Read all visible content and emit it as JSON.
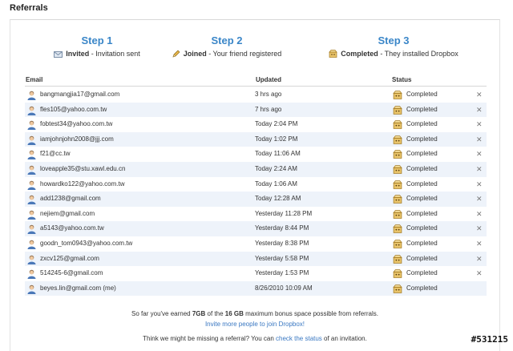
{
  "page": {
    "title": "Referrals"
  },
  "steps": [
    {
      "title": "Step 1",
      "status": "Invited",
      "desc": " - Invitation sent",
      "icon": "envelope-icon"
    },
    {
      "title": "Step 2",
      "status": "Joined",
      "desc": " - Your friend registered",
      "icon": "pencil-icon"
    },
    {
      "title": "Step 3",
      "status": "Completed",
      "desc": " - They installed Dropbox",
      "icon": "dropbox-box-icon"
    }
  ],
  "table": {
    "headers": {
      "email": "Email",
      "updated": "Updated",
      "status": "Status"
    },
    "rows": [
      {
        "email": "bangmangjia17@gmail.com",
        "updated": "3 hrs ago",
        "status": "Completed",
        "removable": true
      },
      {
        "email": "fles105@yahoo.com.tw",
        "updated": "7 hrs ago",
        "status": "Completed",
        "removable": true
      },
      {
        "email": "fobtest34@yahoo.com.tw",
        "updated": "Today 2:04 PM",
        "status": "Completed",
        "removable": true
      },
      {
        "email": "iamjohnjohn2008@jjj.com",
        "updated": "Today 1:02 PM",
        "status": "Completed",
        "removable": true
      },
      {
        "email": "f21@cc.tw",
        "updated": "Today 11:06 AM",
        "status": "Completed",
        "removable": true
      },
      {
        "email": "loveapple35@stu.xawl.edu.cn",
        "updated": "Today 2:24 AM",
        "status": "Completed",
        "removable": true
      },
      {
        "email": "howardko122@yahoo.com.tw",
        "updated": "Today 1:06 AM",
        "status": "Completed",
        "removable": true
      },
      {
        "email": "add1238@gmail.com",
        "updated": "Today 12:28 AM",
        "status": "Completed",
        "removable": true
      },
      {
        "email": "nejiem@gmail.com",
        "updated": "Yesterday 11:28 PM",
        "status": "Completed",
        "removable": true
      },
      {
        "email": "a5143@yahoo.com.tw",
        "updated": "Yesterday 8:44 PM",
        "status": "Completed",
        "removable": true
      },
      {
        "email": "goodn_tom0943@yahoo.com.tw",
        "updated": "Yesterday 8:38 PM",
        "status": "Completed",
        "removable": true
      },
      {
        "email": "zxcv125@gmail.com",
        "updated": "Yesterday 5:58 PM",
        "status": "Completed",
        "removable": true
      },
      {
        "email": "514245-6@gmail.com",
        "updated": "Yesterday 1:53 PM",
        "status": "Completed",
        "removable": true
      },
      {
        "email": "beyes.lin@gmail.com (me)",
        "updated": "8/26/2010 10:09 AM",
        "status": "Completed",
        "removable": false
      }
    ],
    "remove_glyph": "✕"
  },
  "footer": {
    "earned_prefix": "So far you've earned ",
    "earned_amount": "7GB",
    "earned_mid": " of the ",
    "earned_max": "16 GB",
    "earned_suffix": " maximum bonus space possible from referrals.",
    "invite_link": "Invite more people to join Dropbox!",
    "missing_prefix": "Think we might be missing a referral? You can ",
    "missing_link": "check the status",
    "missing_suffix": " of an invitation."
  },
  "watermark": "#531215",
  "colors": {
    "step_title": "#3a86c8",
    "link": "#3a78c2",
    "row_alt": "#eef3fa"
  }
}
